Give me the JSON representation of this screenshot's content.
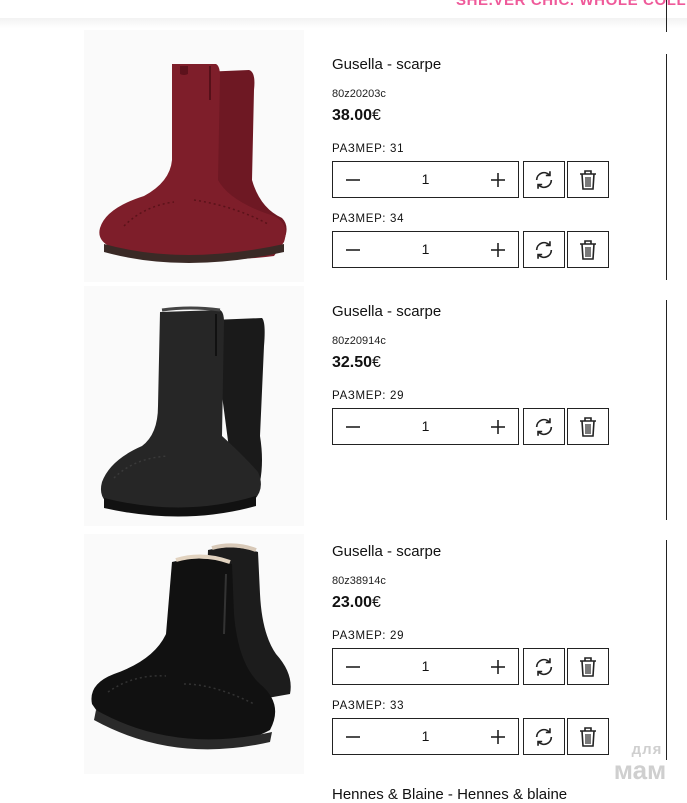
{
  "header": {
    "banner_text": "SHE.VER CHIC. WHOLE COLLECT"
  },
  "products": [
    {
      "image_name": "burgundy suede boot",
      "title": "Gusella - scarpe",
      "sku": "80z20203c",
      "price_amount": "38.00",
      "currency": "€",
      "color": "#7a1d28",
      "sizes": [
        {
          "label": "РАЗМЕР: 31",
          "quantity": "1"
        },
        {
          "label": "РАЗМЕР: 34",
          "quantity": "1"
        }
      ]
    },
    {
      "image_name": "black suede boot",
      "title": "Gusella - scarpe",
      "sku": "80z20914c",
      "price_amount": "32.50",
      "currency": "€",
      "color": "#1f1f1f",
      "sizes": [
        {
          "label": "РАЗМЕР: 29",
          "quantity": "1"
        }
      ]
    },
    {
      "image_name": "black leather chelsea boots",
      "title": "Gusella - scarpe",
      "sku": "80z38914c",
      "price_amount": "23.00",
      "currency": "€",
      "color": "#141414",
      "sizes": [
        {
          "label": "РАЗМЕР: 29",
          "quantity": "1"
        },
        {
          "label": "РАЗМЕР: 33",
          "quantity": "1"
        }
      ]
    }
  ],
  "next_product": {
    "title_partial": "Hennes & Blaine - Hennes & blaine"
  },
  "watermark": {
    "line1": "для",
    "line2": "мам"
  },
  "icons": {
    "minus": "minus-icon",
    "plus": "plus-icon",
    "refresh": "refresh-icon",
    "delete": "trash-icon"
  }
}
